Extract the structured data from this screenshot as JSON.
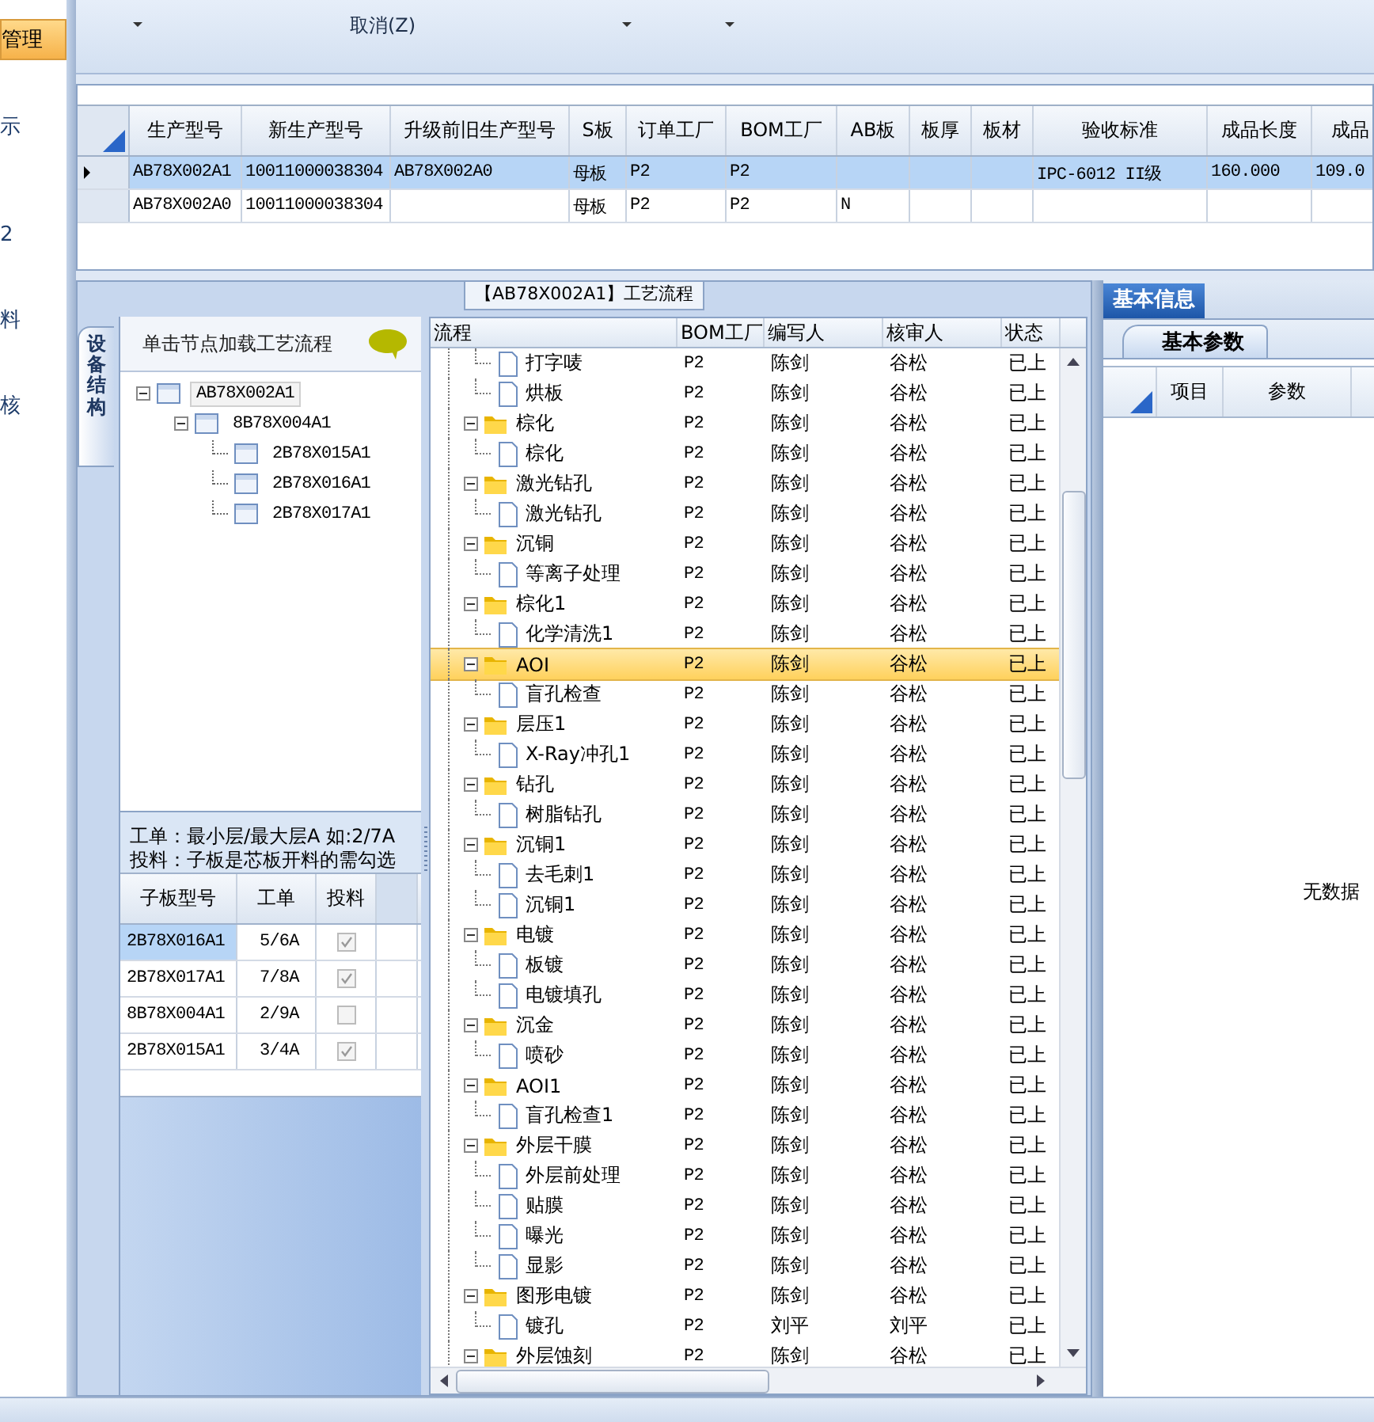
{
  "nav": {
    "items": [
      {
        "label": "管理",
        "selected": true
      },
      {
        "label": "示",
        "selected": false
      },
      {
        "label": "2",
        "selected": false
      },
      {
        "label": "料",
        "selected": false
      },
      {
        "label": "核",
        "selected": false
      }
    ]
  },
  "ribbon": {
    "commands": [
      {
        "label": "取消(Z)"
      }
    ]
  },
  "product_grid": {
    "columns": [
      "生产型号",
      "新生产型号",
      "升级前旧生产型号",
      "S板",
      "订单工厂",
      "BOM工厂",
      "AB板",
      "板厚",
      "板材",
      "验收标准",
      "成品长度",
      "成品"
    ],
    "rows": [
      {
        "selected": true,
        "cells": [
          "AB78X002A1",
          "10011000038304",
          "AB78X002A0",
          "母板",
          "P2",
          "P2",
          "",
          "",
          "",
          "IPC-6012 II级",
          "160.000",
          "109.0"
        ]
      },
      {
        "selected": false,
        "cells": [
          "AB78X002A0",
          "10011000038304",
          "",
          "母板",
          "P2",
          "P2",
          "N",
          "",
          "",
          "",
          "",
          ""
        ]
      }
    ]
  },
  "process_panel": {
    "title": "【AB78X002A1】工艺流程",
    "structure_tab": "设备结构",
    "tree_hint": "单击节点加载工艺流程",
    "board_tree": {
      "label": "AB78X002A1",
      "selected": true,
      "children": [
        {
          "label": "8B78X004A1",
          "selected": false,
          "children": [
            {
              "label": "2B78X015A1",
              "selected": false
            },
            {
              "label": "2B78X016A1",
              "selected": false
            },
            {
              "label": "2B78X017A1",
              "selected": false
            }
          ]
        }
      ]
    },
    "notes": [
      "工单：最小层/最大层A 如:2/7A",
      "投料：子板是芯板开料的需勾选"
    ],
    "sub_grid": {
      "columns": [
        "子板型号",
        "工单",
        "投料"
      ],
      "rows": [
        {
          "model": "2B78X016A1",
          "work_order": "5/6A",
          "feed": true,
          "selected": true
        },
        {
          "model": "2B78X017A1",
          "work_order": "7/8A",
          "feed": true,
          "selected": false
        },
        {
          "model": "8B78X004A1",
          "work_order": "2/9A",
          "feed": false,
          "selected": false
        },
        {
          "model": "2B78X015A1",
          "work_order": "3/4A",
          "feed": true,
          "selected": false
        }
      ]
    },
    "flow_grid": {
      "columns": [
        "流程",
        "BOM工厂",
        "编写人",
        "核审人",
        "状态"
      ],
      "groups": [
        {
          "children": [
            {
              "label": "打字唛",
              "selected": false,
              "cells": [
                "P2",
                "陈剑",
                "谷松",
                "已上"
              ]
            },
            {
              "label": "烘板",
              "selected": false,
              "cells": [
                "P2",
                "陈剑",
                "谷松",
                "已上"
              ]
            }
          ]
        },
        {
          "label": "棕化",
          "selected": false,
          "cells": [
            "P2",
            "陈剑",
            "谷松",
            "已上"
          ],
          "children": [
            {
              "label": "棕化",
              "selected": false,
              "cells": [
                "P2",
                "陈剑",
                "谷松",
                "已上"
              ]
            }
          ]
        },
        {
          "label": "激光钻孔",
          "selected": false,
          "cells": [
            "P2",
            "陈剑",
            "谷松",
            "已上"
          ],
          "children": [
            {
              "label": "激光钻孔",
              "selected": false,
              "cells": [
                "P2",
                "陈剑",
                "谷松",
                "已上"
              ]
            }
          ]
        },
        {
          "label": "沉铜",
          "selected": false,
          "cells": [
            "P2",
            "陈剑",
            "谷松",
            "已上"
          ],
          "children": [
            {
              "label": "等离子处理",
              "selected": false,
              "cells": [
                "P2",
                "陈剑",
                "谷松",
                "已上"
              ]
            }
          ]
        },
        {
          "label": "棕化1",
          "selected": false,
          "cells": [
            "P2",
            "陈剑",
            "谷松",
            "已上"
          ],
          "children": [
            {
              "label": "化学清洗1",
              "selected": false,
              "cells": [
                "P2",
                "陈剑",
                "谷松",
                "已上"
              ]
            }
          ]
        },
        {
          "label": "AOI",
          "selected": true,
          "cells": [
            "P2",
            "陈剑",
            "谷松",
            "已上"
          ],
          "children": [
            {
              "label": "盲孔检查",
              "selected": false,
              "cells": [
                "P2",
                "陈剑",
                "谷松",
                "已上"
              ]
            }
          ]
        },
        {
          "label": "层压1",
          "selected": false,
          "cells": [
            "P2",
            "陈剑",
            "谷松",
            "已上"
          ],
          "children": [
            {
              "label": "X-Ray冲孔1",
              "selected": false,
              "cells": [
                "P2",
                "陈剑",
                "谷松",
                "已上"
              ]
            }
          ]
        },
        {
          "label": "钻孔",
          "selected": false,
          "cells": [
            "P2",
            "陈剑",
            "谷松",
            "已上"
          ],
          "children": [
            {
              "label": "树脂钻孔",
              "selected": false,
              "cells": [
                "P2",
                "陈剑",
                "谷松",
                "已上"
              ]
            }
          ]
        },
        {
          "label": "沉铜1",
          "selected": false,
          "cells": [
            "P2",
            "陈剑",
            "谷松",
            "已上"
          ],
          "children": [
            {
              "label": "去毛刺1",
              "selected": false,
              "cells": [
                "P2",
                "陈剑",
                "谷松",
                "已上"
              ]
            },
            {
              "label": "沉铜1",
              "selected": false,
              "cells": [
                "P2",
                "陈剑",
                "谷松",
                "已上"
              ]
            }
          ]
        },
        {
          "label": "电镀",
          "selected": false,
          "cells": [
            "P2",
            "陈剑",
            "谷松",
            "已上"
          ],
          "children": [
            {
              "label": "板镀",
              "selected": false,
              "cells": [
                "P2",
                "陈剑",
                "谷松",
                "已上"
              ]
            },
            {
              "label": "电镀填孔",
              "selected": false,
              "cells": [
                "P2",
                "陈剑",
                "谷松",
                "已上"
              ]
            }
          ]
        },
        {
          "label": "沉金",
          "selected": false,
          "cells": [
            "P2",
            "陈剑",
            "谷松",
            "已上"
          ],
          "children": [
            {
              "label": "喷砂",
              "selected": false,
              "cells": [
                "P2",
                "陈剑",
                "谷松",
                "已上"
              ]
            }
          ]
        },
        {
          "label": "AOI1",
          "selected": false,
          "cells": [
            "P2",
            "陈剑",
            "谷松",
            "已上"
          ],
          "children": [
            {
              "label": "盲孔检查1",
              "selected": false,
              "cells": [
                "P2",
                "陈剑",
                "谷松",
                "已上"
              ]
            }
          ]
        },
        {
          "label": "外层干膜",
          "selected": false,
          "cells": [
            "P2",
            "陈剑",
            "谷松",
            "已上"
          ],
          "children": [
            {
              "label": "外层前处理",
              "selected": false,
              "cells": [
                "P2",
                "陈剑",
                "谷松",
                "已上"
              ]
            },
            {
              "label": "贴膜",
              "selected": false,
              "cells": [
                "P2",
                "陈剑",
                "谷松",
                "已上"
              ]
            },
            {
              "label": "曝光",
              "selected": false,
              "cells": [
                "P2",
                "陈剑",
                "谷松",
                "已上"
              ]
            },
            {
              "label": "显影",
              "selected": false,
              "cells": [
                "P2",
                "陈剑",
                "谷松",
                "已上"
              ]
            }
          ]
        },
        {
          "label": "图形电镀",
          "selected": false,
          "cells": [
            "P2",
            "陈剑",
            "谷松",
            "已上"
          ],
          "children": [
            {
              "label": "镀孔",
              "selected": false,
              "cells": [
                "P2",
                "刘平",
                "刘平",
                "已上"
              ]
            }
          ]
        },
        {
          "label": "外层蚀刻",
          "selected": false,
          "cells": [
            "P2",
            "陈剑",
            "谷松",
            "已上"
          ]
        }
      ]
    }
  },
  "info_panel": {
    "tab": "基本信息",
    "sub_tab": "基本参数",
    "columns": [
      "项目",
      "参数"
    ],
    "empty_text": "无数据"
  }
}
